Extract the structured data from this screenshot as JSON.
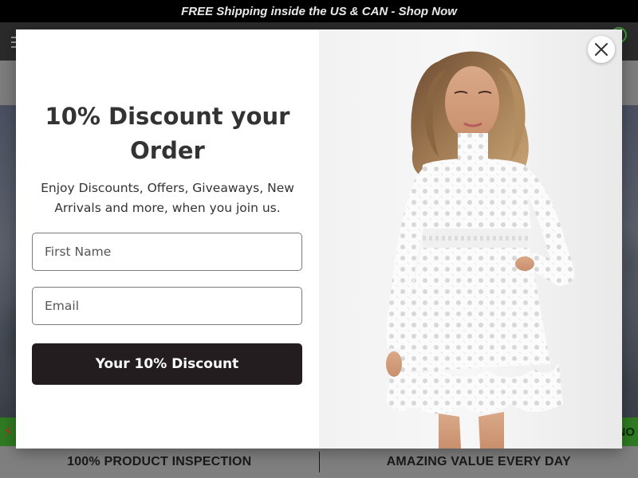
{
  "announcement": {
    "text": "FREE Shipping inside the US & CAN - Shop Now"
  },
  "background": {
    "marquee_tail": "NO",
    "features": [
      "100% PRODUCT INSPECTION",
      "AMAZING VALUE EVERY DAY"
    ]
  },
  "popup": {
    "heading": "10% Discount your Order",
    "subtext": "Enjoy Discounts, Offers, Giveaways, New Arrivals and more, when you join us.",
    "first_name_placeholder": "First Name",
    "email_placeholder": "Email",
    "submit_label": "Your 10% Discount",
    "close_icon": "close-icon",
    "image_alt": "model-in-white-lace-dress"
  },
  "colors": {
    "button_bg": "#231d1f",
    "announce_bg": "#000000",
    "marquee_bg": "#3ca52c"
  }
}
